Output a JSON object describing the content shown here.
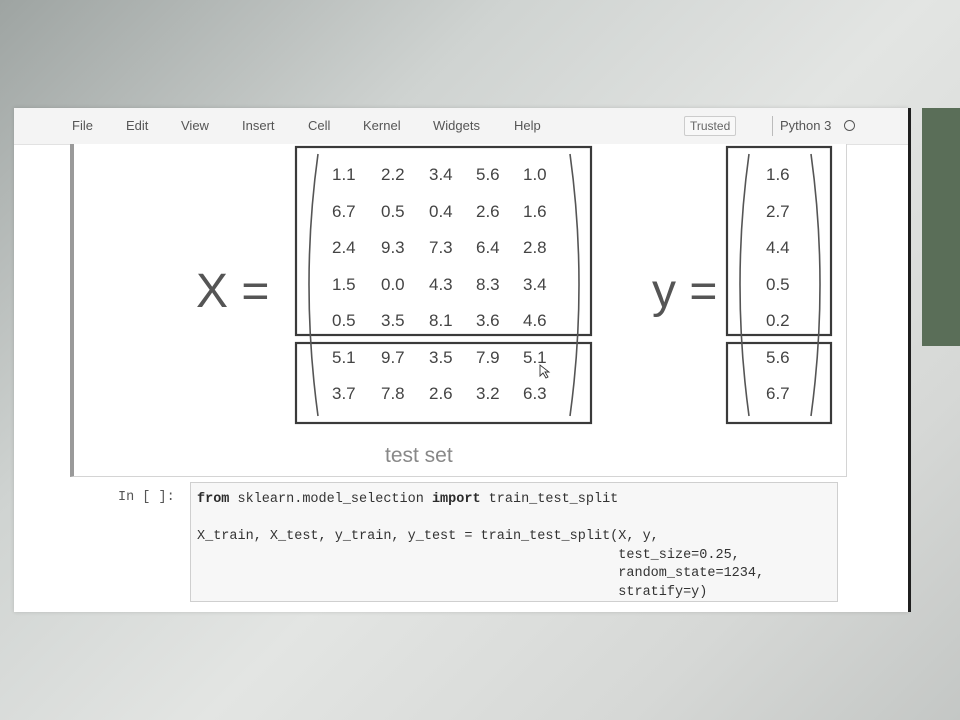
{
  "menu": {
    "items": [
      "File",
      "Edit",
      "View",
      "Insert",
      "Cell",
      "Kernel",
      "Widgets",
      "Help"
    ],
    "trusted": "Trusted",
    "kernel": "Python 3"
  },
  "figure": {
    "x_label": "X =",
    "y_label": "y =",
    "test_label": "test set",
    "X_rows": [
      [
        "1.1",
        "2.2",
        "3.4",
        "5.6",
        "1.0"
      ],
      [
        "6.7",
        "0.5",
        "0.4",
        "2.6",
        "1.6"
      ],
      [
        "2.4",
        "9.3",
        "7.3",
        "6.4",
        "2.8"
      ],
      [
        "1.5",
        "0.0",
        "4.3",
        "8.3",
        "3.4"
      ],
      [
        "0.5",
        "3.5",
        "8.1",
        "3.6",
        "4.6"
      ],
      [
        "5.1",
        "9.7",
        "3.5",
        "7.9",
        "5.1"
      ],
      [
        "3.7",
        "7.8",
        "2.6",
        "3.2",
        "6.3"
      ]
    ],
    "y_values": [
      "1.6",
      "2.7",
      "4.4",
      "0.5",
      "0.2",
      "5.6",
      "6.7"
    ]
  },
  "code_cell": {
    "prompt": "In [ ]:",
    "kw_from": "from",
    "module": " sklearn.model_selection ",
    "kw_import": "import",
    "func": " train_test_split",
    "line2": "X_train, X_test, y_train, y_test = train_test_split(X, y,",
    "line3": "                                                    test_size=0.25,",
    "line4": "                                                    random_state=1234,",
    "line5": "                                                    stratify=y)"
  }
}
